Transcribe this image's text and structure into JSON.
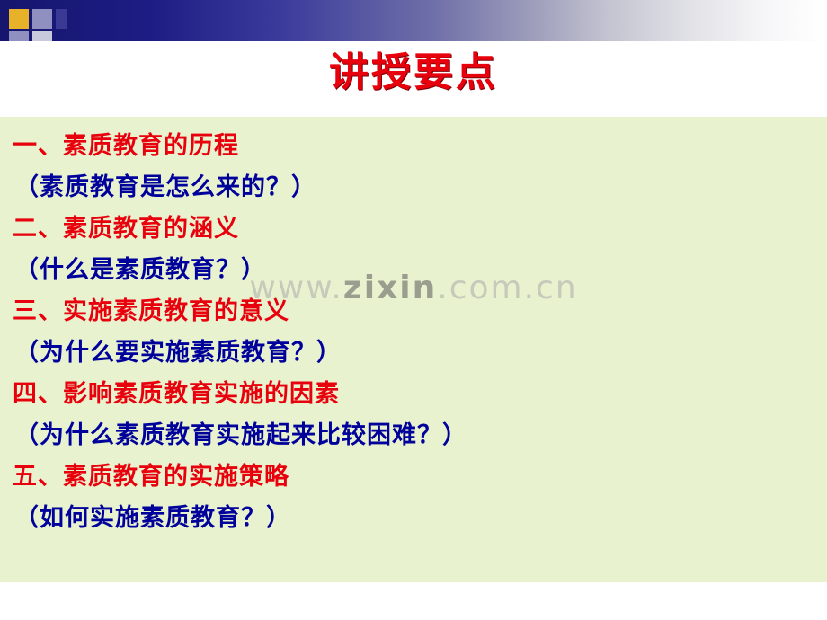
{
  "slide": {
    "title": "讲授要点",
    "title_color": "#e8000d",
    "panel_color": "#e9f2cf",
    "heading_color": "#e8000d",
    "sub_color": "#00009b",
    "lines": [
      {
        "type": "heading",
        "text": "一、素质教育的历程"
      },
      {
        "type": "sub",
        "text": "（素质教育是怎么来的？）"
      },
      {
        "type": "heading",
        "text": "二、素质教育的涵义"
      },
      {
        "type": "sub",
        "text": "（什么是素质教育？）"
      },
      {
        "type": "heading",
        "text": "三、实施素质教育的意义"
      },
      {
        "type": "sub",
        "text": "（为什么要实施素质教育？）"
      },
      {
        "type": "heading",
        "text": "四、影响素质教育实施的因素"
      },
      {
        "type": "sub",
        "text": "（为什么素质教育实施起来比较困难？）"
      },
      {
        "type": "heading",
        "text": "五、素质教育的实施策略"
      },
      {
        "type": "sub",
        "text": "（如何实施素质教育？）"
      }
    ]
  },
  "watermark": {
    "prefix": "www.",
    "brand": "zixin",
    "suffix": ".com.cn"
  }
}
